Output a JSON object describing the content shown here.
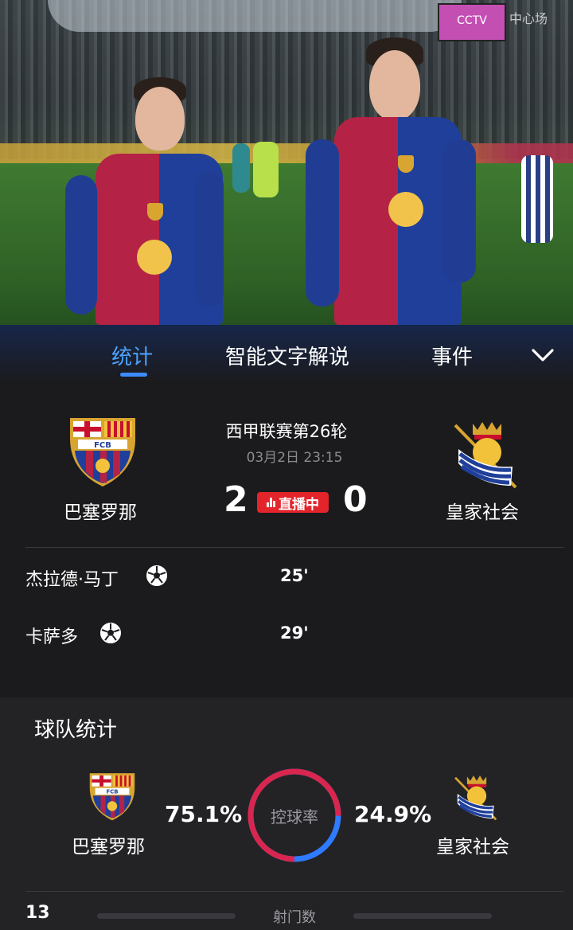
{
  "hero": {
    "screen_text": "CCTV",
    "watermark": "中心场"
  },
  "tabs": [
    {
      "label": "统计",
      "active": true
    },
    {
      "label": "智能文字解说",
      "active": false
    },
    {
      "label": "事件",
      "active": false
    }
  ],
  "match": {
    "league": "西甲联赛第26轮",
    "datetime": "03月2日 23:15",
    "home": {
      "name": "巴塞罗那",
      "score": "2",
      "crest_text": "FCB"
    },
    "away": {
      "name": "皇家社会",
      "score": "0"
    },
    "status": "直播中"
  },
  "goals": [
    {
      "scorer": "杰拉德·马丁",
      "minute": "25'"
    },
    {
      "scorer": "卡萨多",
      "minute": "29'"
    }
  ],
  "team_stats": {
    "title": "球队统计",
    "home_name": "巴塞罗那",
    "away_name": "皇家社会",
    "possession": {
      "label": "控球率",
      "home": "75.1%",
      "away": "24.9%",
      "home_fraction": 0.751
    },
    "shots": {
      "label": "射门数",
      "home": "13"
    }
  },
  "colors": {
    "accent_blue": "#3d8bff",
    "live_red": "#e3242b",
    "home_ring": "#d8264f",
    "away_ring": "#2f7bff"
  }
}
